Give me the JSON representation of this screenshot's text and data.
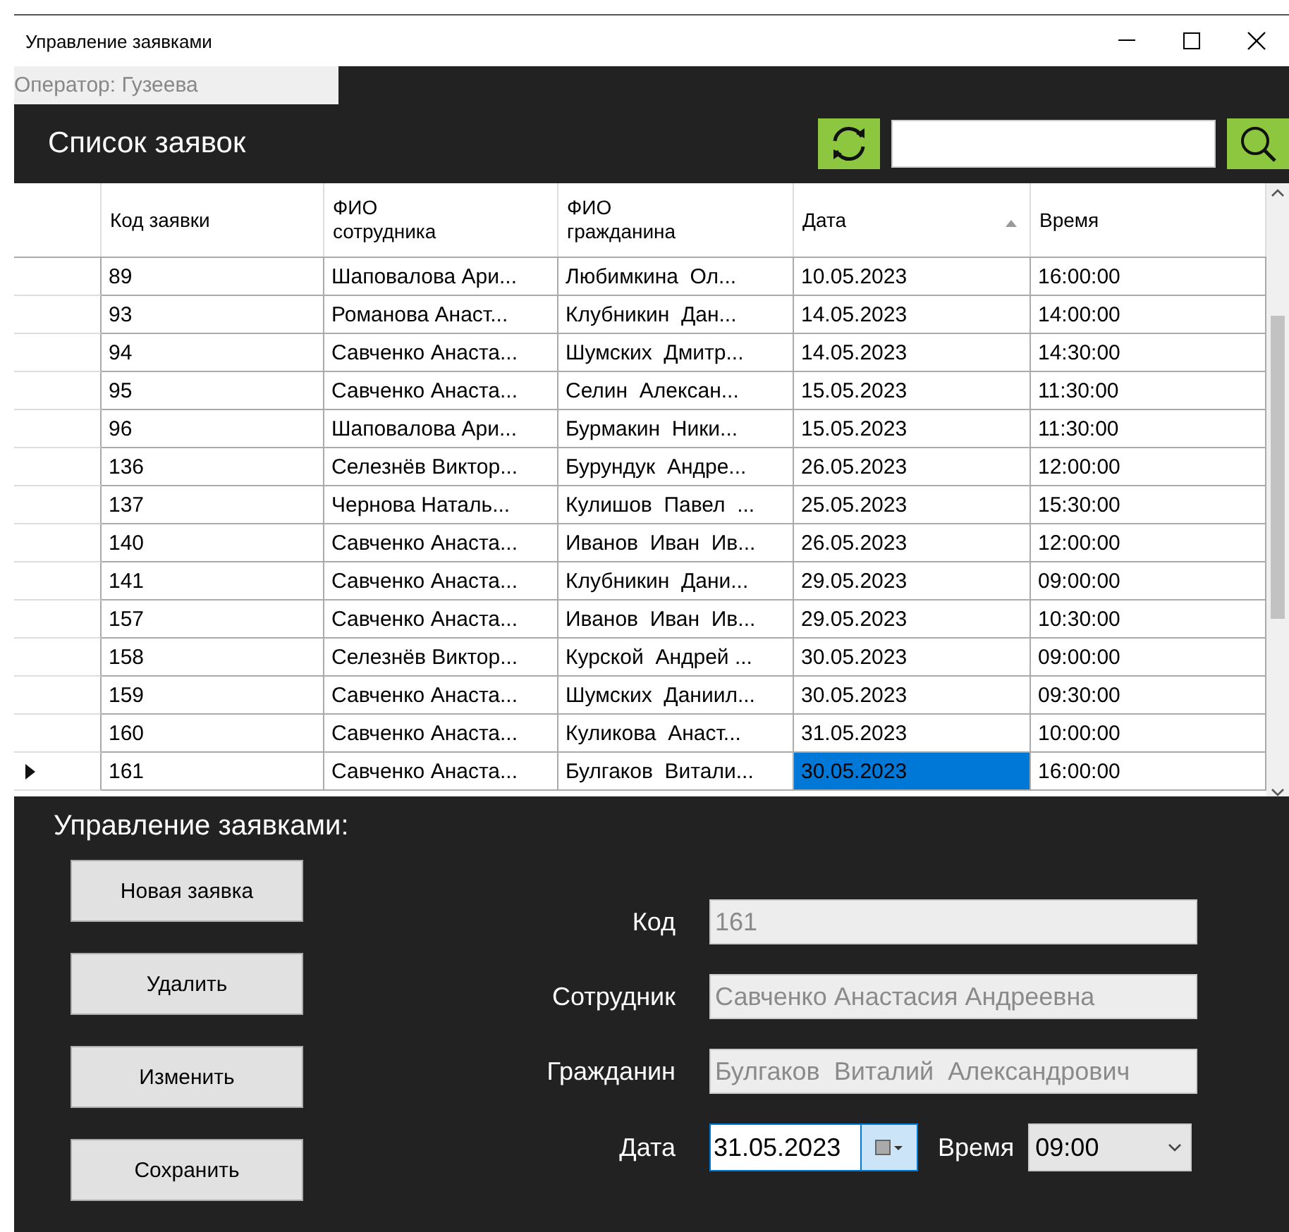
{
  "window": {
    "title": "Управление заявками"
  },
  "operator": "Оператор: Гузеева",
  "list_title": "Список заявок",
  "table": {
    "columns": [
      {
        "label": "Код заявки",
        "sorted": false
      },
      {
        "label": "ФИО\nсотрудника",
        "sorted": false
      },
      {
        "label": "ФИО\nгражданина",
        "sorted": false
      },
      {
        "label": "Дата",
        "sorted": true
      },
      {
        "label": "Время",
        "sorted": false
      }
    ],
    "rows": [
      {
        "current": false,
        "cells": [
          {
            "text": "89",
            "selected": false
          },
          {
            "text": "Шаповалова Ари...",
            "selected": false
          },
          {
            "text": "Любимкина  Ол...",
            "selected": false
          },
          {
            "text": "10.05.2023",
            "selected": false
          },
          {
            "text": "16:00:00",
            "selected": false
          }
        ]
      },
      {
        "current": false,
        "cells": [
          {
            "text": "93",
            "selected": false
          },
          {
            "text": "Романова Анаст...",
            "selected": false
          },
          {
            "text": "Клубникин  Дан...",
            "selected": false
          },
          {
            "text": "14.05.2023",
            "selected": false
          },
          {
            "text": "14:00:00",
            "selected": false
          }
        ]
      },
      {
        "current": false,
        "cells": [
          {
            "text": "94",
            "selected": false
          },
          {
            "text": "Савченко Анаста...",
            "selected": false
          },
          {
            "text": "Шумских  Дмитр...",
            "selected": false
          },
          {
            "text": "14.05.2023",
            "selected": false
          },
          {
            "text": "14:30:00",
            "selected": false
          }
        ]
      },
      {
        "current": false,
        "cells": [
          {
            "text": "95",
            "selected": false
          },
          {
            "text": "Савченко Анаста...",
            "selected": false
          },
          {
            "text": "Селин  Алексан...",
            "selected": false
          },
          {
            "text": "15.05.2023",
            "selected": false
          },
          {
            "text": "11:30:00",
            "selected": false
          }
        ]
      },
      {
        "current": false,
        "cells": [
          {
            "text": "96",
            "selected": false
          },
          {
            "text": "Шаповалова Ари...",
            "selected": false
          },
          {
            "text": "Бурмакин  Ники...",
            "selected": false
          },
          {
            "text": "15.05.2023",
            "selected": false
          },
          {
            "text": "11:30:00",
            "selected": false
          }
        ]
      },
      {
        "current": false,
        "cells": [
          {
            "text": "136",
            "selected": false
          },
          {
            "text": "Селезнёв Виктор...",
            "selected": false
          },
          {
            "text": "Бурундук  Андре...",
            "selected": false
          },
          {
            "text": "26.05.2023",
            "selected": false
          },
          {
            "text": "12:00:00",
            "selected": false
          }
        ]
      },
      {
        "current": false,
        "cells": [
          {
            "text": "137",
            "selected": false
          },
          {
            "text": "Чернова Наталь...",
            "selected": false
          },
          {
            "text": "Кулишов  Павел  ...",
            "selected": false
          },
          {
            "text": "25.05.2023",
            "selected": false
          },
          {
            "text": "15:30:00",
            "selected": false
          }
        ]
      },
      {
        "current": false,
        "cells": [
          {
            "text": "140",
            "selected": false
          },
          {
            "text": "Савченко Анаста...",
            "selected": false
          },
          {
            "text": "Иванов  Иван  Ив...",
            "selected": false
          },
          {
            "text": "26.05.2023",
            "selected": false
          },
          {
            "text": "12:00:00",
            "selected": false
          }
        ]
      },
      {
        "current": false,
        "cells": [
          {
            "text": "141",
            "selected": false
          },
          {
            "text": "Савченко Анаста...",
            "selected": false
          },
          {
            "text": "Клубникин  Дани...",
            "selected": false
          },
          {
            "text": "29.05.2023",
            "selected": false
          },
          {
            "text": "09:00:00",
            "selected": false
          }
        ]
      },
      {
        "current": false,
        "cells": [
          {
            "text": "157",
            "selected": false
          },
          {
            "text": "Савченко Анаста...",
            "selected": false
          },
          {
            "text": "Иванов  Иван  Ив...",
            "selected": false
          },
          {
            "text": "29.05.2023",
            "selected": false
          },
          {
            "text": "10:30:00",
            "selected": false
          }
        ]
      },
      {
        "current": false,
        "cells": [
          {
            "text": "158",
            "selected": false
          },
          {
            "text": "Селезнёв Виктор...",
            "selected": false
          },
          {
            "text": "Курской  Андрей ...",
            "selected": false
          },
          {
            "text": "30.05.2023",
            "selected": false
          },
          {
            "text": "09:00:00",
            "selected": false
          }
        ]
      },
      {
        "current": false,
        "cells": [
          {
            "text": "159",
            "selected": false
          },
          {
            "text": "Савченко Анаста...",
            "selected": false
          },
          {
            "text": "Шумских  Даниил...",
            "selected": false
          },
          {
            "text": "30.05.2023",
            "selected": false
          },
          {
            "text": "09:30:00",
            "selected": false
          }
        ]
      },
      {
        "current": false,
        "cells": [
          {
            "text": "160",
            "selected": false
          },
          {
            "text": "Савченко Анаста...",
            "selected": false
          },
          {
            "text": "Куликова  Анаст...",
            "selected": false
          },
          {
            "text": "31.05.2023",
            "selected": false
          },
          {
            "text": "10:00:00",
            "selected": false
          }
        ]
      },
      {
        "current": true,
        "cells": [
          {
            "text": "161",
            "selected": false
          },
          {
            "text": "Савченко Анаста...",
            "selected": false
          },
          {
            "text": "Булгаков  Витали...",
            "selected": false
          },
          {
            "text": "30.05.2023",
            "selected": true
          },
          {
            "text": "16:00:00",
            "selected": false
          }
        ]
      }
    ]
  },
  "manage_title": "Управление заявками:",
  "buttons": [
    "Новая заявка",
    "Удалить",
    "Изменить",
    "Сохранить"
  ],
  "form": {
    "code": {
      "label": "Код",
      "value": "161",
      "disabled": true
    },
    "employee": {
      "label": "Сотрудник",
      "value": "Савченко Анастасия Андреевна",
      "disabled": true
    },
    "citizen": {
      "label": "Гражданин",
      "value": "Булгаков  Виталий  Александрович",
      "disabled": true
    },
    "date": {
      "label": "Дата",
      "value": "31.05.2023",
      "focused": true
    },
    "time": {
      "label": "Время",
      "value": "09:00"
    }
  }
}
